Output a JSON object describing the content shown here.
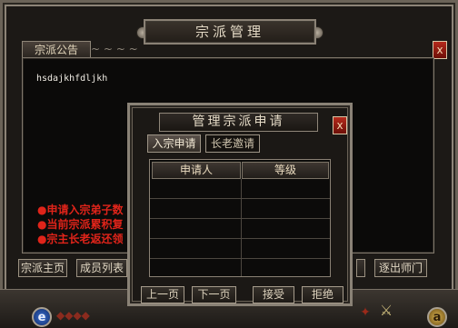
{
  "main_window": {
    "title": "宗派管理",
    "close_symbol": "x",
    "notice_tab": "宗派公告",
    "notice_text": "hsdajkhfdljkh",
    "info_lines": [
      "●申请入宗弟子数",
      "●当前宗派累积复",
      "●宗主长老返还领"
    ],
    "buttons": {
      "home": "宗派主页",
      "members": "成员列表",
      "leave": "逐出师门"
    }
  },
  "dialog": {
    "title": "管理宗派申请",
    "close_symbol": "x",
    "tabs": {
      "join_requests": "入宗申请",
      "elder_invites": "长老邀请"
    },
    "table": {
      "columns": [
        "申请人",
        "等级"
      ],
      "rows": []
    },
    "buttons": {
      "prev_page": "上一页",
      "next_page": "下一页",
      "accept": "接受",
      "reject": "拒绝"
    }
  },
  "bottom_bar": {
    "e_orb": "e",
    "a_orb": "a"
  },
  "colors": {
    "accent_red": "#e0241a",
    "border_stone": "#8a8276",
    "panel_bg": "#0b0a09"
  }
}
